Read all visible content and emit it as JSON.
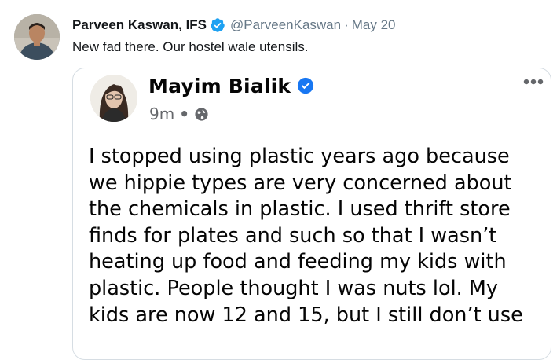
{
  "tweet": {
    "author_name": "Parveen Kaswan, IFS",
    "handle": "@ParveenKaswan",
    "separator": "·",
    "date": "May 20",
    "text": "New fad there. Our hostel wale utensils.",
    "verified_icon": "verified-badge-icon",
    "accent_color": "#1da1f2"
  },
  "quoted_post": {
    "author_name": "Mayim Bialik",
    "time": "9m",
    "meta_separator": "•",
    "visibility_icon": "globe-icon",
    "more_icon": "more-horizontal-icon",
    "verified_color": "#1877f2",
    "body_lines": [
      "I stopped using plastic years ago because",
      "we hippie types are very concerned about",
      "the chemicals in plastic. I used thrift store",
      "finds for plates and such so that I wasn’t",
      "heating up food and feeding my kids with",
      "plastic. People thought I was nuts lol. My",
      "kids are now 12 and 15, but I still don’t use"
    ]
  }
}
